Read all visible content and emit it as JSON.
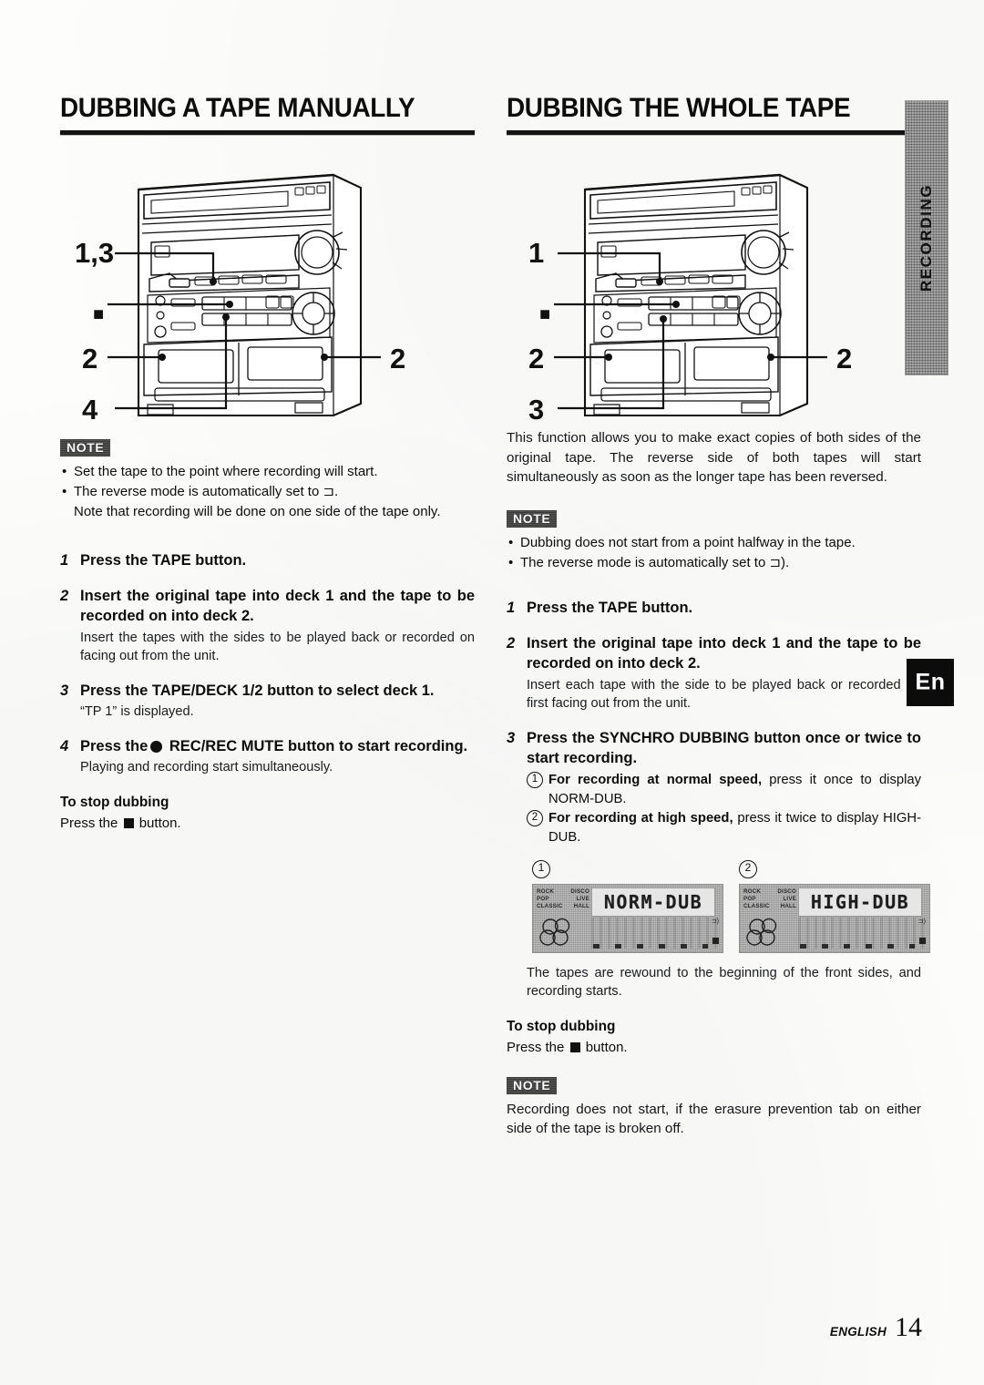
{
  "page": {
    "footer_label": "ENGLISH",
    "footer_page": "14"
  },
  "side_tabs": {
    "chapter": "RECORDING",
    "language": "En"
  },
  "left_column": {
    "title": "DUBBING A TAPE MANUALLY",
    "diagram": {
      "callouts": [
        "1,3",
        "■",
        "2",
        "2",
        "4"
      ],
      "alt": "Mini hi-fi system front panel line drawing with numbered callouts"
    },
    "note": {
      "badge": "NOTE",
      "items": [
        "Set the tape to the point where recording will start.",
        "The reverse mode is automatically set to ⊐.",
        "Note that recording will be done on one side of the tape only."
      ]
    },
    "steps": [
      {
        "num": "1",
        "head": "Press the TAPE button.",
        "sub": ""
      },
      {
        "num": "2",
        "head": "Insert the original tape into deck 1 and the tape to be recorded on into deck 2.",
        "sub": "Insert the tapes with the sides to be played back or recorded on facing out from the unit."
      },
      {
        "num": "3",
        "head": "Press the TAPE/DECK 1/2 button to select deck 1.",
        "sub": "“TP 1” is displayed."
      },
      {
        "num": "4",
        "head_before": "Press the",
        "head_after": "REC/REC MUTE button to start recording.",
        "sub": "Playing and recording start simultaneously."
      }
    ],
    "stop": {
      "heading": "To stop dubbing",
      "before": "Press the",
      "after": "button."
    }
  },
  "right_column": {
    "title": "DUBBING THE WHOLE TAPE",
    "diagram": {
      "callouts": [
        "1",
        "■",
        "2",
        "2",
        "3"
      ],
      "alt": "Mini hi-fi system front panel line drawing with numbered callouts"
    },
    "intro": "This function allows you to make exact copies of both sides of the original tape. The reverse side of both tapes will start simultaneously as soon as the longer tape has been reversed.",
    "note": {
      "badge": "NOTE",
      "items": [
        "Dubbing does not start from a point halfway in the tape.",
        "The reverse mode is automatically set to ⊐)."
      ]
    },
    "steps": [
      {
        "num": "1",
        "head": "Press the TAPE button.",
        "sub": ""
      },
      {
        "num": "2",
        "head": "Insert the original tape into deck 1 and the tape to be recorded on into deck 2.",
        "sub": "Insert each tape with the side to be played back or recorded on first facing out from the unit."
      },
      {
        "num": "3",
        "head": "Press the SYNCHRO DUBBING button once or twice to start recording.",
        "sublist": [
          {
            "mark": "1",
            "bold": "For recording at normal speed,",
            "rest": " press it once to display NORM-DUB."
          },
          {
            "mark": "2",
            "bold": "For recording at high speed,",
            "rest": " press it twice to display HIGH-DUB."
          }
        ]
      }
    ],
    "lcd_figures": [
      {
        "caption": "1",
        "display_text": "NORM-DUB",
        "labels": [
          "ROCK",
          "DISCO",
          "POP",
          "LIVE",
          "CLASSIC",
          "HALL"
        ]
      },
      {
        "caption": "2",
        "display_text": "HIGH-DUB",
        "labels": [
          "ROCK",
          "DISCO",
          "POP",
          "LIVE",
          "CLASSIC",
          "HALL"
        ]
      }
    ],
    "after_figures": "The tapes are rewound to the beginning of the front sides, and recording starts.",
    "stop": {
      "heading": "To stop dubbing",
      "before": "Press the",
      "after": "button."
    },
    "bottom_note": {
      "badge": "NOTE",
      "text": "Recording does not start, if the erasure prevention tab on either side of the tape is broken off."
    }
  }
}
